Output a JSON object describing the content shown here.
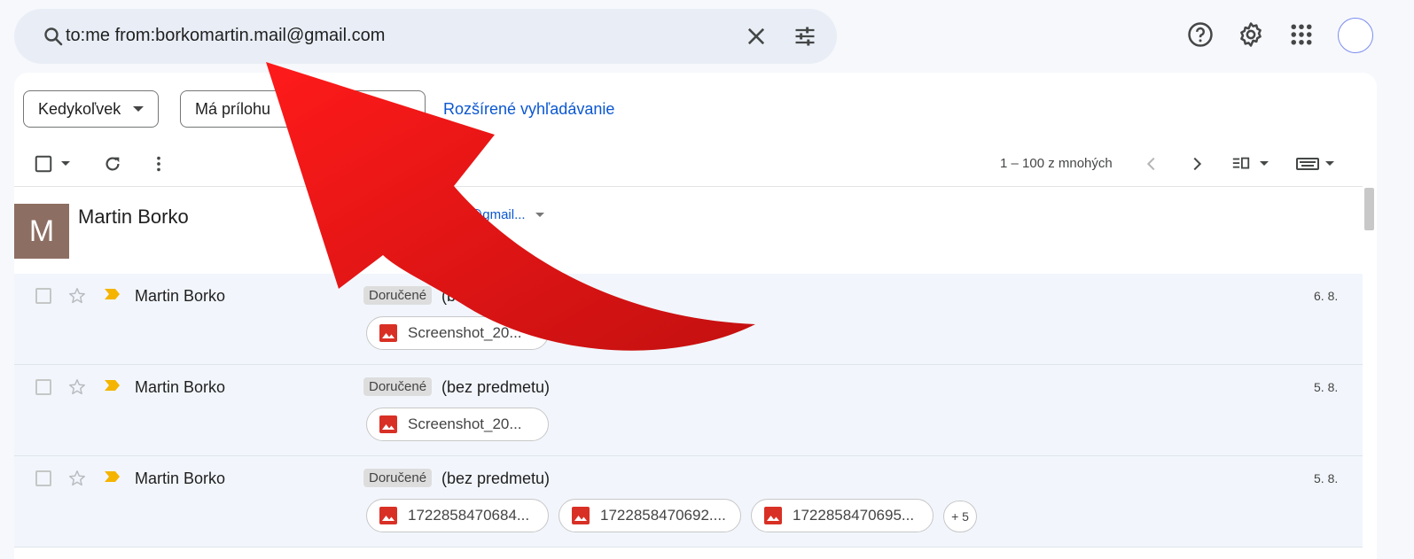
{
  "search": {
    "query": "to:me from:borkomartin.mail@gmail.com"
  },
  "filters": {
    "chips": [
      {
        "label": "Kedykoľvek"
      },
      {
        "label": "Má prílohu"
      }
    ],
    "advanced_link": "Rozšírené vyhľadávanie"
  },
  "toolbar": {
    "pager": "1 – 100 z mnohých"
  },
  "contact": {
    "initial": "M",
    "name": "Martin Borko",
    "email_truncated": "@gmail..."
  },
  "rows": [
    {
      "sender": "Martin Borko",
      "label": "Doručené",
      "subject": "(b",
      "date": "6. 8.",
      "attachments": [
        "Screenshot_20..."
      ]
    },
    {
      "sender": "Martin Borko",
      "label": "Doručené",
      "subject": "(bez predmetu)",
      "date": "5. 8.",
      "attachments": [
        "Screenshot_20..."
      ]
    },
    {
      "sender": "Martin Borko",
      "label": "Doručené",
      "subject": "(bez predmetu)",
      "date": "5. 8.",
      "attachments": [
        "1722858470684...",
        "1722858470692....",
        "1722858470695..."
      ],
      "more_count": "+ 5"
    }
  ],
  "colors": {
    "accent": "#0b57d0",
    "arrow": "#e50914",
    "important": "#f4b400",
    "attachment_icon": "#d93025"
  },
  "icons": [
    "search-icon",
    "close-icon",
    "tune-icon",
    "help-icon",
    "gear-icon",
    "apps-icon",
    "checkbox-icon",
    "refresh-icon",
    "more-vert-icon",
    "chevron-left-icon",
    "chevron-right-icon",
    "split-pane-icon",
    "keyboard-icon",
    "star-icon",
    "important-icon",
    "image-icon"
  ]
}
